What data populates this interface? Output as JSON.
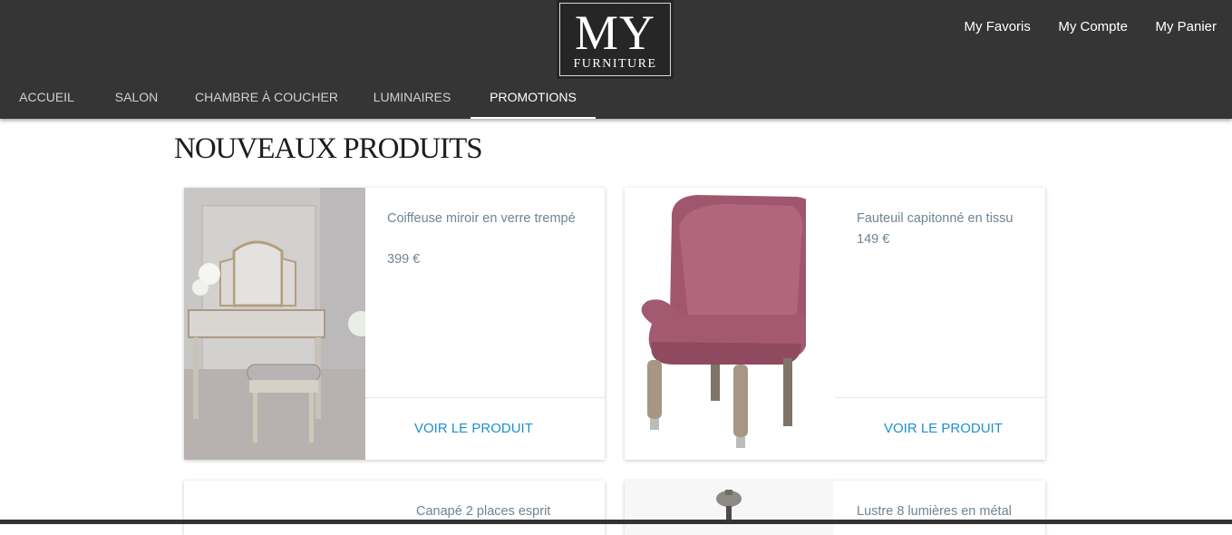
{
  "header": {
    "logo": {
      "main": "MY",
      "sub": "FURNITURE"
    },
    "top_links": [
      "My Favoris",
      "My Compte",
      "My Panier"
    ],
    "nav": [
      "ACCUEIL",
      "SALON",
      "CHAMBRE À COUCHER",
      "LUMINAIRES",
      "PROMOTIONS"
    ],
    "active_nav": "PROMOTIONS"
  },
  "main": {
    "section_title": "NOUVEAUX PRODUITS",
    "products": [
      {
        "name": "Coiffeuse miroir en verre trempé",
        "price": "399 €",
        "link": "VOIR LE PRODUIT"
      },
      {
        "name": "Fauteuil capitonné en tissu",
        "price": "149 €",
        "link": "VOIR LE PRODUIT"
      },
      {
        "name": "Canapé 2 places esprit",
        "price": "",
        "link": ""
      },
      {
        "name": "Lustre 8 lumières en métal",
        "price": "",
        "link": ""
      }
    ]
  },
  "colors": {
    "header_bg": "#353535",
    "link_blue": "#1f8fd0",
    "product_text": "#6e8594"
  }
}
